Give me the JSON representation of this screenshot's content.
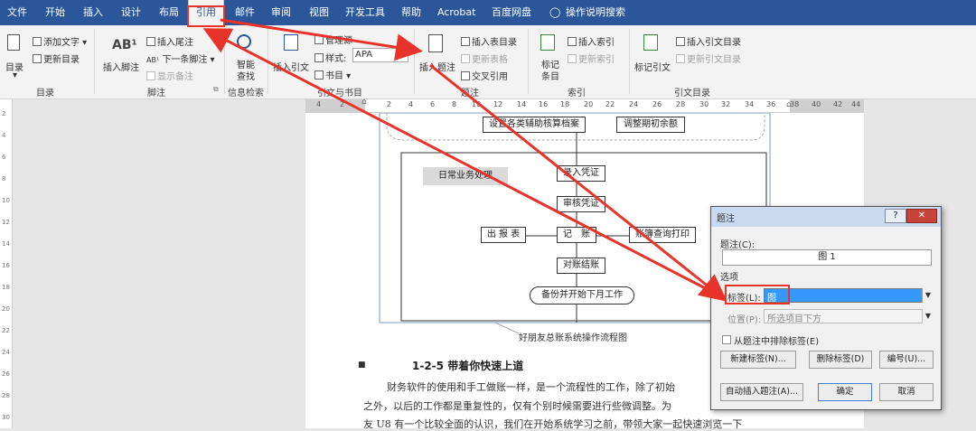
{
  "menubar": {
    "tabs": [
      "文件",
      "开始",
      "插入",
      "设计",
      "布局",
      "引用",
      "邮件",
      "审阅",
      "视图",
      "开发工具",
      "帮助",
      "Acrobat",
      "百度网盘",
      "操作说明搜索"
    ],
    "active": "引用"
  },
  "ribbon": {
    "toc": {
      "big": "目录",
      "add_text": "添加文字",
      "update_toc": "更新目录",
      "group": "目录"
    },
    "footnote": {
      "big_icon": "AB¹",
      "big": "插入脚注",
      "insert_endnote": "插入尾注",
      "next_footnote": "下一条脚注",
      "show_notes": "显示备注",
      "group": "脚注"
    },
    "research": {
      "big": "智能查找",
      "group": "信息检索"
    },
    "citations": {
      "big": "插入引文",
      "manage": "管理源",
      "style_label": "样式:",
      "style_value": "APA",
      "bibliography": "书目",
      "group": "引文与书目"
    },
    "captions": {
      "big": "插入题注",
      "insert_tof": "插入表目录",
      "update_table": "更新表格",
      "cross_ref": "交叉引用",
      "group": "题注"
    },
    "index": {
      "big": "标记条目",
      "insert_index": "插入索引",
      "update_index": "更新索引",
      "group": "索引"
    },
    "toa": {
      "big": "标记引文",
      "insert_toa": "插入引文目录",
      "update_toa": "更新引文目录",
      "group": "引文目录"
    }
  },
  "ruler": {
    "ticks": [
      "4",
      "2",
      "2",
      "4",
      "6",
      "8",
      "10",
      "12",
      "14",
      "16",
      "18",
      "20",
      "22",
      "24",
      "26",
      "28",
      "30",
      "32",
      "34",
      "36",
      "38",
      "40",
      "42",
      "44"
    ]
  },
  "vruler": {
    "ticks": [
      "2",
      "4",
      "6",
      "8",
      "10",
      "12",
      "14",
      "16",
      "18",
      "20",
      "22",
      "24",
      "26",
      "28",
      "30"
    ]
  },
  "flowchart": {
    "top_box1": "设置各类辅助核算档案",
    "top_box2": "调整期初余额",
    "group_label": "日常业务处理",
    "step1": "录入凭证",
    "step2": "审核凭证",
    "step3": "记　账",
    "left_out": "出 报 表",
    "right_out": "账簿查询打印",
    "step4": "对账结账",
    "step5": "备份并开始下月工作"
  },
  "document": {
    "caption": "好朋友总账系统操作流程图",
    "heading": "1-2-5 带着你快速上道",
    "line1": "财务软件的使用和手工做账一样，是一个流程性的工作，除了初始",
    "line2": "之外，以后的工作都是重复性的，仅有个别时候需要进行些微调整。为",
    "line3": "友 U8 有一个比较全面的认识，我们在开始系统学习之前，带领大家一起快速浏览一下"
  },
  "dialog": {
    "title": "题注",
    "caption_label": "题注(C):",
    "caption_value": "图 1",
    "options_label": "选项",
    "label_label": "标签(L):",
    "label_value": "图",
    "position_label": "位置(P):",
    "position_value": "所选项目下方",
    "exclude_label": "从题注中排除标签(E)",
    "new_label": "新建标签(N)...",
    "delete_label": "删除标签(D)",
    "numbering": "编号(U)...",
    "autocaption": "自动插入题注(A)...",
    "ok": "确定",
    "cancel": "取消",
    "help": "?",
    "close": "✕"
  },
  "colors": {
    "accent": "#2b579a",
    "annotation": "#e8332a",
    "selection": "#3399ff"
  }
}
